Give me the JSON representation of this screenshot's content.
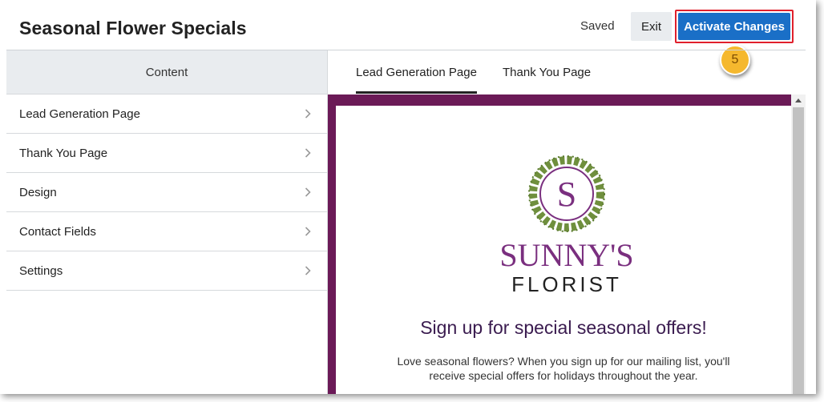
{
  "header": {
    "title": "Seasonal Flower Specials",
    "saved_label": "Saved",
    "exit_label": "Exit",
    "activate_label": "Activate Changes",
    "step_number": "5"
  },
  "sidebar": {
    "heading": "Content",
    "items": [
      {
        "label": "Lead Generation Page"
      },
      {
        "label": "Thank You Page"
      },
      {
        "label": "Design"
      },
      {
        "label": "Contact Fields"
      },
      {
        "label": "Settings"
      }
    ]
  },
  "tabs": [
    {
      "label": "Lead Generation Page",
      "active": true
    },
    {
      "label": "Thank You Page",
      "active": false
    }
  ],
  "preview": {
    "logo_letter": "S",
    "logo_name_line1": "SUNNY'S",
    "logo_name_line2": "FLORIST",
    "heading": "Sign up for special seasonal offers!",
    "body_line1": "Love seasonal flowers? When you sign up for our mailing list, you'll",
    "body_line2": "receive special offers for holidays throughout the year."
  },
  "colors": {
    "accent_blue": "#1a6fc7",
    "highlight_red": "#e0202c",
    "badge_orange": "#f5b82e",
    "preview_frame": "#6b1a57",
    "logo_purple": "#7a2f7f",
    "logo_green": "#6f8f3d"
  },
  "icons": {
    "chevron": "chevron-right-icon",
    "scroll_up": "caret-up-icon"
  }
}
